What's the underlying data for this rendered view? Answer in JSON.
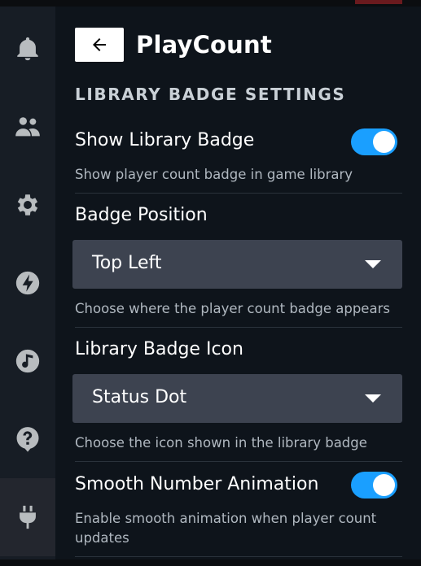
{
  "plugin": {
    "title": "PlayCount"
  },
  "section_title": "LIBRARY BADGE SETTINGS",
  "sidebar": {
    "items": [
      {
        "icon": "bell-icon"
      },
      {
        "icon": "friends-icon"
      },
      {
        "icon": "gear-icon"
      },
      {
        "icon": "lightning-icon"
      },
      {
        "icon": "music-icon"
      },
      {
        "icon": "help-icon"
      },
      {
        "icon": "plug-icon",
        "active": true
      }
    ]
  },
  "settings": {
    "show_badge": {
      "label": "Show Library Badge",
      "description": "Show player count badge in game library",
      "enabled": true
    },
    "badge_position": {
      "label": "Badge Position",
      "value": "Top Left",
      "description": "Choose where the player count badge appears"
    },
    "badge_icon": {
      "label": "Library Badge Icon",
      "value": "Status Dot",
      "description": "Choose the icon shown in the library badge"
    },
    "smooth_animation": {
      "label": "Smooth Number Animation",
      "description": "Enable smooth animation when player count updates",
      "enabled": true
    }
  },
  "colors": {
    "accent": "#1a9fff",
    "background": "#0e141b",
    "sidebar": "#171d25",
    "dropdown": "#3d4350"
  }
}
